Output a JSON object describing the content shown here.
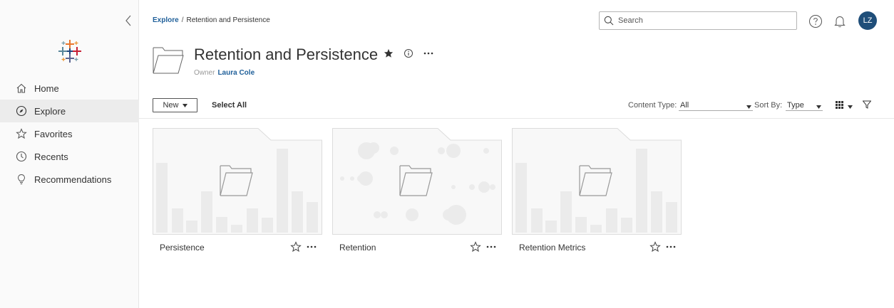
{
  "sidebar": {
    "collapse_icon": "chevron-left-icon",
    "logo_icon": "tableau-logo-icon",
    "items": [
      {
        "label": "Home",
        "icon": "home-icon",
        "active": false
      },
      {
        "label": "Explore",
        "icon": "compass-icon",
        "active": true
      },
      {
        "label": "Favorites",
        "icon": "star-outline-icon",
        "active": false
      },
      {
        "label": "Recents",
        "icon": "clock-icon",
        "active": false
      },
      {
        "label": "Recommendations",
        "icon": "lightbulb-icon",
        "active": false
      }
    ]
  },
  "header": {
    "breadcrumb": {
      "root": "Explore",
      "separator": "/",
      "current": "Retention and Persistence"
    },
    "search": {
      "placeholder": "Search"
    },
    "avatar_initials": "LZ",
    "avatar_color": "#1f4e79"
  },
  "project": {
    "title": "Retention and Persistence",
    "owner_label": "Owner",
    "owner_name": "Laura Cole"
  },
  "toolbar": {
    "new_label": "New",
    "select_all_label": "Select All",
    "content_type_label": "Content Type:",
    "content_type_value": "All",
    "sort_label": "Sort By:",
    "sort_value": "Type"
  },
  "cards": [
    {
      "name": "Persistence",
      "thumbnail": "bar-pattern"
    },
    {
      "name": "Retention",
      "thumbnail": "bubble-pattern"
    },
    {
      "name": "Retention Metrics",
      "thumbnail": "bar-pattern"
    }
  ],
  "colors": {
    "link": "#1f5f99",
    "sidebar_bg": "#fafafa",
    "active_bg": "#ececec",
    "thumb_bg": "#f8f8f8",
    "thumb_shape": "#ebebeb"
  }
}
